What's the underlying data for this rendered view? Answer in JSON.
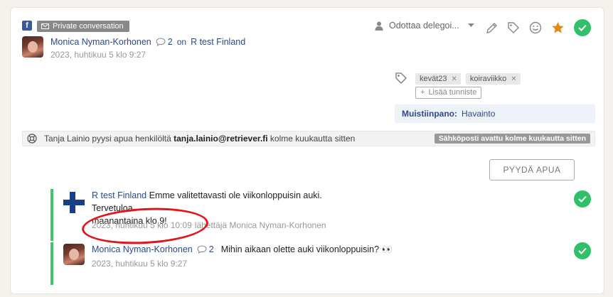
{
  "header": {
    "channel_icon": "facebook-icon",
    "private_label": "Private conversation",
    "author": "Monica Nyman-Korhonen",
    "comment_count": "2",
    "on_word": "on",
    "page_name": "R test Finland",
    "timestamp": "2023, huhtikuu 5 klo 9:27"
  },
  "toolbar": {
    "delegate_status": "Odottaa delegoi...",
    "icons": [
      "person-icon",
      "chevron-down-icon",
      "pencil-icon",
      "tag-icon",
      "smiley-icon",
      "star-icon",
      "check-icon"
    ]
  },
  "tags": {
    "items": [
      {
        "label": "kevät23"
      },
      {
        "label": "koiraviikko"
      }
    ],
    "add_label": "Lisää tunniste"
  },
  "note": {
    "label": "Muistiinpano:",
    "value": "Havainto"
  },
  "help_request": {
    "text_prefix": "Tanja Lainio pyysi apua henkilöltä",
    "email": "tanja.lainio@retriever.fi",
    "text_suffix": "kolme kuukautta sitten",
    "email_status": "Sähköposti avattu kolme kuukautta sitten"
  },
  "ask_help_button": "PYYDÄ APUA",
  "messages": [
    {
      "author": "R test Finland",
      "text_line1": "Emme valitettavasti ole viikonloppuisin auki. Tervetuloa",
      "text_line2": "maanantaina klo 9!",
      "timestamp": "2023, huhtikuu 5 klo 10:09",
      "sender_note": "lähettäjä Monica Nyman-Korhonen"
    },
    {
      "author": "Monica Nyman-Korhonen",
      "comment_count": "2",
      "text": "Mihin aikaan olette auki viikonloppuisin? 👀",
      "timestamp": "2023, huhtikuu 5 klo 9:27"
    }
  ],
  "colors": {
    "accent_green": "#2fc06a",
    "thread_bar": "#42c56f",
    "link_blue": "#2c4a8a",
    "star_orange": "#e08a16",
    "annotation_red": "#e3141a"
  }
}
